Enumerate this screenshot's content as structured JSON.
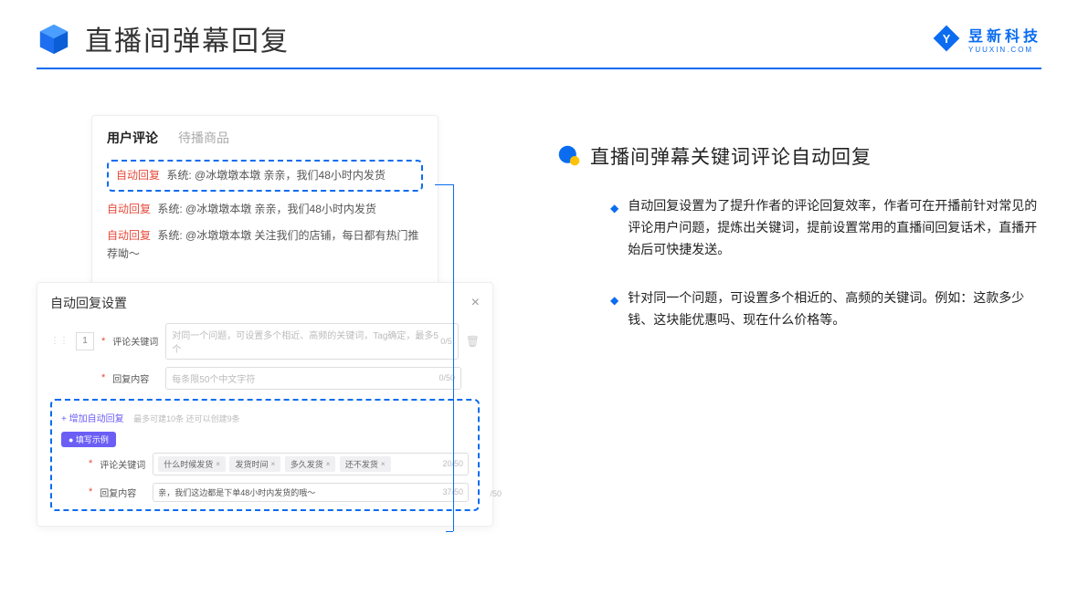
{
  "header": {
    "title": "直播间弹幕回复",
    "logo_main": "昱新科技",
    "logo_sub": "YUUXIN.COM"
  },
  "comment_panel": {
    "tabs": {
      "active": "用户评论",
      "inactive": "待播商品"
    },
    "rows": [
      {
        "tag": "自动回复",
        "text": "系统: @冰墩墩本墩 亲亲，我们48小时内发货"
      },
      {
        "tag": "自动回复",
        "text": "系统: @冰墩墩本墩 亲亲，我们48小时内发货"
      },
      {
        "tag": "自动回复",
        "text": "系统: @冰墩墩本墩 关注我们的店铺，每日都有热门推荐呦～"
      }
    ]
  },
  "settings": {
    "title": "自动回复设置",
    "order": "1",
    "row1": {
      "label": "评论关键词",
      "placeholder": "对同一个问题，可设置多个相近、高频的关键词，Tag确定，最多5个",
      "counter": "0/5"
    },
    "row2": {
      "label": "回复内容",
      "placeholder": "每条限50个中文字符",
      "counter": "0/50"
    },
    "add_link": "+ 增加自动回复",
    "add_hint": "最多可建10条 还可以创建9条",
    "example_badge": "● 填写示例",
    "ex1": {
      "label": "评论关键词",
      "tags": [
        "什么时候发货",
        "发货时间",
        "多久发货",
        "还不发货"
      ],
      "counter": "20/50"
    },
    "ex2": {
      "label": "回复内容",
      "text": "亲，我们这边都是下单48小时内发货的哦～",
      "counter": "37/50"
    },
    "extra_counter": "/50"
  },
  "right": {
    "section_title": "直播间弹幕关键词评论自动回复",
    "bullets": [
      "自动回复设置为了提升作者的评论回复效率，作者可在开播前针对常见的评论用户问题，提炼出关键词，提前设置常用的直播间回复话术，直播开始后可快捷发送。",
      "针对同一个问题，可设置多个相近的、高频的关键词。例如：这款多少钱、这块能优惠吗、现在什么价格等。"
    ]
  }
}
